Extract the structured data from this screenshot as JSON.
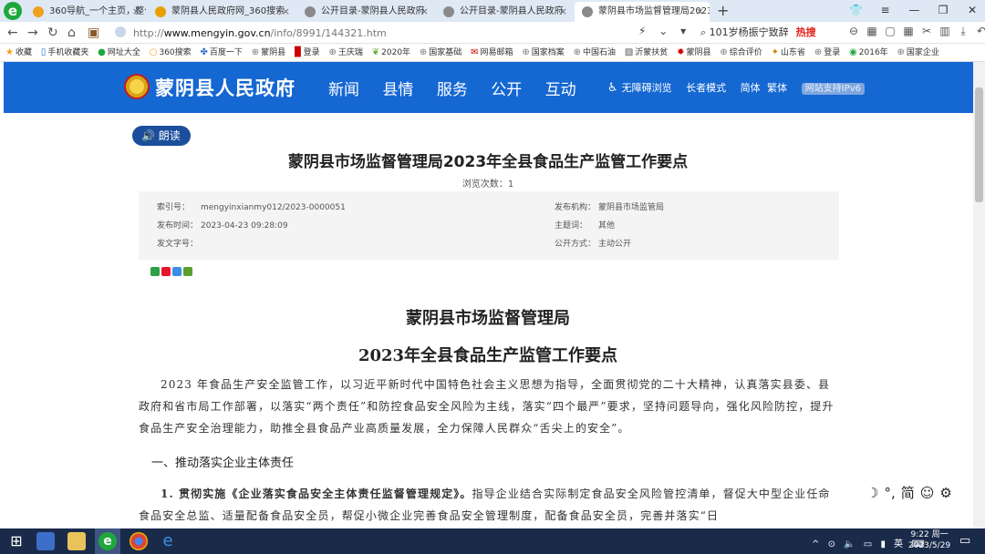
{
  "browser": {
    "tabs": [
      {
        "title": "360导航_一个主页，整个世界",
        "active": false,
        "color": "#f0a020"
      },
      {
        "title": "蒙阴县人民政府网_360搜索",
        "active": false,
        "color": "#e8a000"
      },
      {
        "title": "公开目录-蒙阴县人民政府",
        "active": false,
        "color": "#8a8a8a"
      },
      {
        "title": "公开目录-蒙阴县人民政府",
        "active": false,
        "color": "#8a8a8a"
      },
      {
        "title": "蒙阴县市场监督管理局2023年",
        "active": true,
        "color": "#8a8a8a"
      }
    ],
    "url_prefix": "http://",
    "url_host": "www.mengyin.gov.cn",
    "url_path": "/info/8991/144321.htm",
    "search_text": "101岁杨振宁致辞",
    "search_hot": "热搜",
    "bookmarks": [
      "收藏",
      "手机收藏夹",
      "网址大全",
      "360搜索",
      "百度一下",
      "蒙阴县",
      "登录",
      "王庆瑞",
      "2020年",
      "国家基础",
      "网易邮箱",
      "国家档案",
      "中国石油",
      "沂蒙扶贫",
      "蒙阴县",
      "综合评价",
      "山东省",
      "登录",
      "2016年",
      "国家企业"
    ]
  },
  "site": {
    "name": "蒙阴县人民政府",
    "nav": [
      "新闻",
      "县情",
      "服务",
      "公开",
      "互动"
    ],
    "tools": [
      "无障碍浏览",
      "长者模式",
      "简体",
      "繁体"
    ],
    "ipv6": "网站支持IPv6"
  },
  "article": {
    "read_label": "朗读",
    "title": "蒙阴县市场监督管理局2023年全县食品生产监管工作要点",
    "views_label": "浏览次数：",
    "views": "1",
    "info": {
      "index_label": "索引号：",
      "index": "mengyinxianmy012/2023-0000051",
      "date_label": "发布时间：",
      "date": "2023-04-23 09:28:09",
      "docno_label": "发文字号：",
      "docno": "",
      "org_label": "发布机构：",
      "org": "蒙阴县市场监管局",
      "topic_label": "主题词：",
      "topic": "其他",
      "mode_label": "公开方式：",
      "mode": "主动公开"
    },
    "doc_title_1": "蒙阴县市场监督管理局",
    "doc_title_2": "2023年全县食品生产监管工作要点",
    "para_1": "2023 年食品生产安全监管工作，以习近平新时代中国特色社会主义思想为指导，全面贯彻党的二十大精神，认真落实县委、县政府和省市局工作部署，以落实“两个责任”和防控食品安全风险为主线，落实“四个最严”要求，坚持问题导向，强化风险防控，提升食品生产安全治理能力，助推全县食品产业高质量发展，全力保障人民群众“舌尖上的安全”。",
    "section_1": "一、推动落实企业主体责任",
    "para_2_bold": "1. 贯彻实施《企业落实食品安全主体责任监督管理规定》。",
    "para_2": "指导企业结合实际制定食品安全风险管控清单，督促大中型企业任命食品安全总监、适量配备食品安全员，帮促小微企业完善食品安全管理制度，配备食品安全员，完善并落实“日"
  },
  "taskbar": {
    "tray_lang": "英",
    "time": "9:22 周一",
    "date": "2023/5/29"
  }
}
